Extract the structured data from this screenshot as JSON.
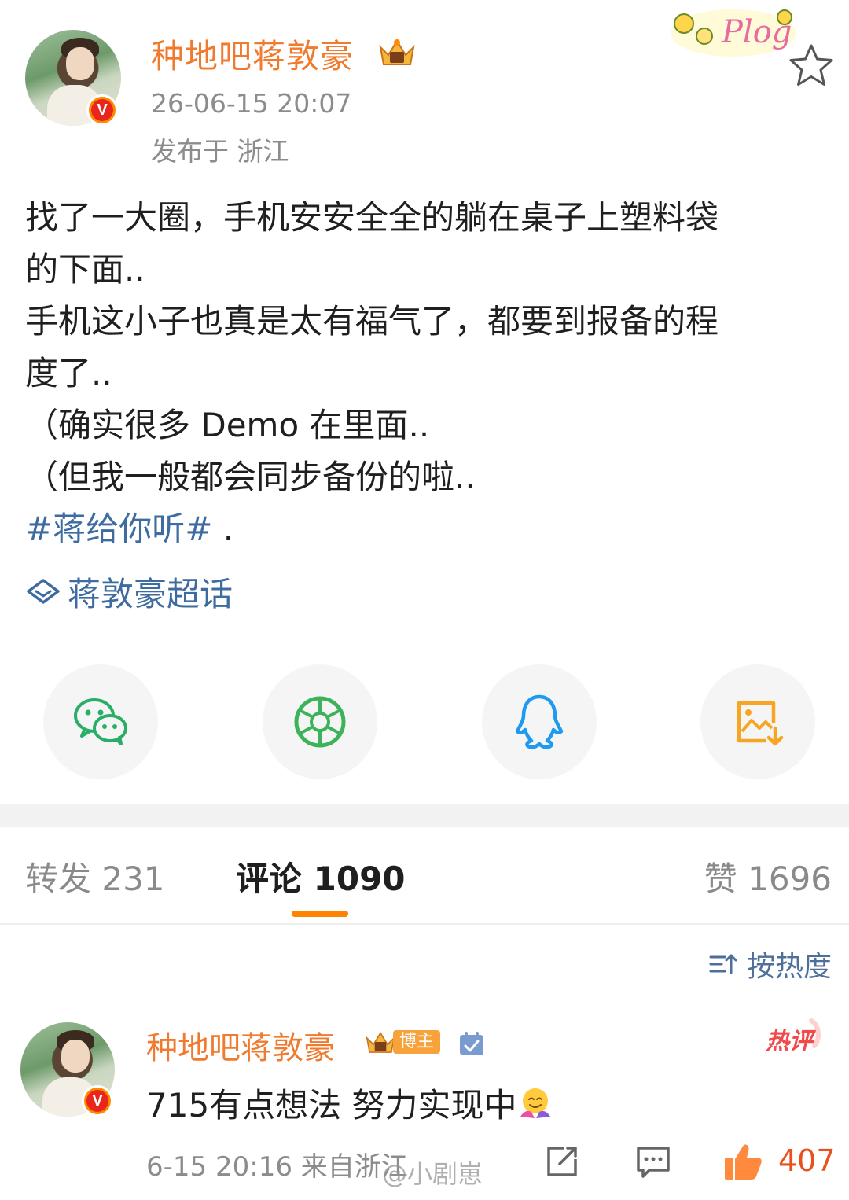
{
  "post": {
    "author": "种地吧蒋敦豪",
    "timestamp": "26-06-15 20:07",
    "location": "发布于 浙江",
    "sticker_text": "Plog",
    "lines": [
      "找了一大圈，手机安安全全的躺在桌子上塑料袋",
      "的下面..",
      "手机这小子也真是太有福气了，都要到报备的程",
      "度了..",
      "（确实很多 Demo 在里面..",
      "（但我一般都会同步备份的啦.."
    ],
    "hashtag": "#蒋给你听#",
    "hashtag_suffix": " .",
    "super_topic": "蒋敦豪超话"
  },
  "share": {
    "icons": [
      "wechat-icon",
      "moments-icon",
      "qq-icon",
      "save-image-icon"
    ]
  },
  "tabs": {
    "repost": "转发 231",
    "comments": "评论 1090",
    "likes": "赞 1696"
  },
  "sort": {
    "label": "按热度"
  },
  "comment": {
    "author": "种地吧蒋敦豪",
    "author_tag": "博主",
    "hot_label": "热评",
    "text": "715有点想法 努力实现中",
    "time_location": "6-15 20:16 来自浙江",
    "likes": "407",
    "watermark": "@小剧崽"
  },
  "colors": {
    "username": "#f07a2e",
    "link": "#3e6ba0",
    "accent": "#ff8200",
    "like": "#e8511c"
  }
}
